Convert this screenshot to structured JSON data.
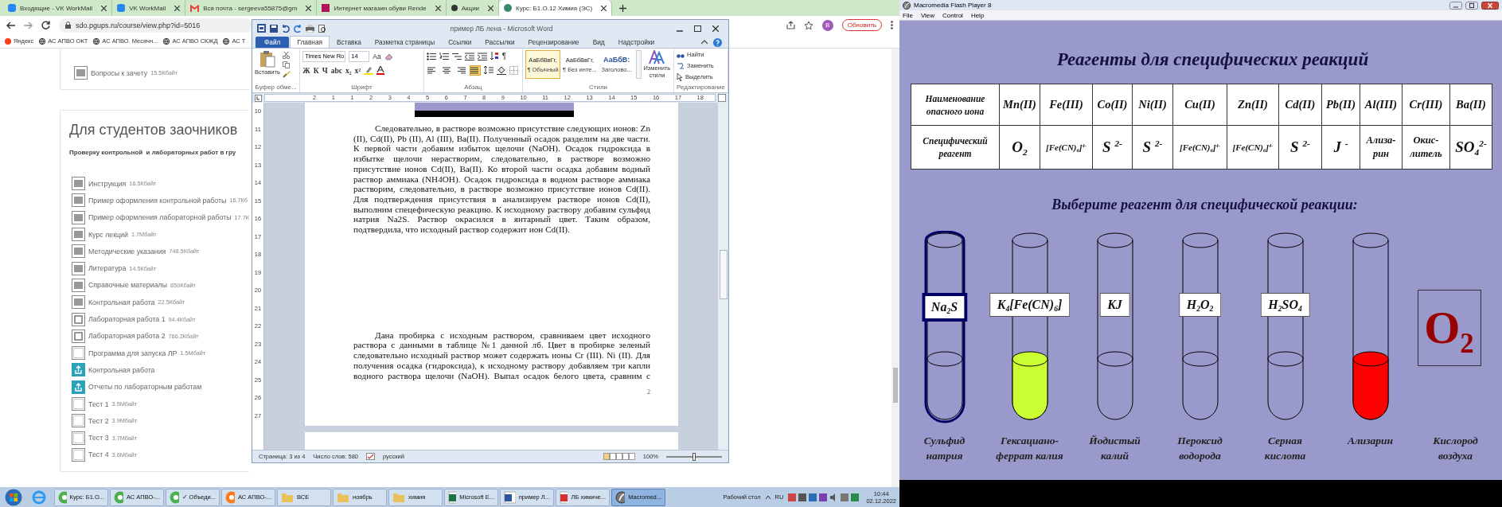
{
  "browser": {
    "tabs": [
      {
        "title": "Входящие - VK WorkMail",
        "selected": false
      },
      {
        "title": "VK WorkMail",
        "selected": false
      },
      {
        "title": "Вся почта - sergeeva55875@gm",
        "selected": false
      },
      {
        "title": "Интернет магазин обуви Rende",
        "selected": false
      },
      {
        "title": "Акции",
        "selected": false
      },
      {
        "title": "Курс: Б1.О.12 Химия (ЭС)",
        "selected": true
      }
    ],
    "address": "sdo.pgups.ru/course/view.php?id=5016",
    "avatar": "В",
    "update_button": "Обновить",
    "bookmarks": [
      "Яндекс",
      "АС АПВО ОКТ",
      "АС АПВО. Месячн...",
      "АС АПВО СКЖД",
      "АС Т"
    ],
    "top_item": {
      "name": "Вопросы к зачету",
      "size": "15.5Кбайт"
    },
    "section": {
      "heading": "Для студентов заочников",
      "subtitle": "Проверку контрольной  и лабораторных работ в гру",
      "files": [
        {
          "name": "Инструкция",
          "size": "16.5Кбайт",
          "kind": "doc"
        },
        {
          "name": "Пример оформления контрольной работы",
          "size": "16.7Кб",
          "kind": "doc"
        },
        {
          "name": "Пример оформления лабораторной работы",
          "size": "17.7К",
          "kind": "doc"
        },
        {
          "name": "Курс лекций",
          "size": "1.7Мбайт",
          "kind": "doc"
        },
        {
          "name": "Методические указания",
          "size": "748.5Кбайт",
          "kind": "doc"
        },
        {
          "name": "Литература",
          "size": "14.5Кбайт",
          "kind": "doc"
        },
        {
          "name": "Справочные материалы",
          "size": "859Кбайт",
          "kind": "doc"
        },
        {
          "name": "Контрольная работа",
          "size": "22.5Кбайт",
          "kind": "doc"
        },
        {
          "name": "Лабораторная работа 1",
          "size": "94.4Кбайт",
          "kind": "archive"
        },
        {
          "name": "Лабораторная работа 2",
          "size": "786.2Кбайт",
          "kind": "archive"
        },
        {
          "name": "Программа для запуска ЛР",
          "size": "1.5Мбайт",
          "kind": "file"
        },
        {
          "name": "Контрольная работа",
          "kind": "assign"
        },
        {
          "name": "Отчеты по лабораторным работам",
          "kind": "assign"
        },
        {
          "name": "Тест 1",
          "size": "3.5Мбайт",
          "kind": "file"
        },
        {
          "name": "Тест 2",
          "size": "3.9Мбайт",
          "kind": "file"
        },
        {
          "name": "Тест 3",
          "size": "3.7Мбайт",
          "kind": "file"
        },
        {
          "name": "Тест 4",
          "size": "3.6Мбайт",
          "kind": "file"
        }
      ]
    }
  },
  "word": {
    "title": "пример ЛБ лена - Microsoft Word",
    "tabs": [
      {
        "label": "Файл",
        "kind": "file",
        "selected": false
      },
      {
        "label": "Главная",
        "kind": "tab",
        "selected": true
      },
      {
        "label": "Вставка",
        "kind": "tab",
        "selected": false
      },
      {
        "label": "Разметка страницы",
        "kind": "tab",
        "selected": false
      },
      {
        "label": "Ссылки",
        "kind": "tab",
        "selected": false
      },
      {
        "label": "Рассылки",
        "kind": "tab",
        "selected": false
      },
      {
        "label": "Рецензирование",
        "kind": "tab",
        "selected": false
      },
      {
        "label": "Вид",
        "kind": "tab",
        "selected": false
      },
      {
        "label": "Надстройки",
        "kind": "tab",
        "selected": false
      }
    ],
    "paste": "Вставить",
    "font_name": "Times New Ro",
    "font_size": "14",
    "case_button": "Aa",
    "font_buttons": [
      "Ж",
      "К",
      "Ч",
      "abc",
      "x₂",
      "x²"
    ],
    "pilcrow": "¶",
    "alignments": [
      {
        "kind": "left",
        "selected": false
      },
      {
        "kind": "center",
        "selected": false
      },
      {
        "kind": "right",
        "selected": false
      },
      {
        "kind": "justify",
        "selected": true
      }
    ],
    "styles": [
      {
        "sample": "АаБбВвГг,",
        "name": "¶ Обычный",
        "kind": "normal",
        "selected": true
      },
      {
        "sample": "АаБбВвГг,",
        "name": "¶ Без инте...",
        "kind": "normal",
        "selected": false
      },
      {
        "sample": "АаБбВ:",
        "name": "Заголово...",
        "kind": "heading",
        "selected": false
      }
    ],
    "change_styles": "Изменить стили",
    "editing": [
      "Найти",
      "Заменить",
      "Выделить"
    ],
    "groups": [
      "Буфер обме...",
      "Шрифт",
      "Абзац",
      "Стили",
      "Редактирование"
    ],
    "ruler": [
      "2",
      "1",
      "1",
      "2",
      "3",
      "4",
      "5",
      "6",
      "7",
      "8",
      "9",
      "10",
      "11",
      "12",
      "13",
      "14",
      "15",
      "16",
      "17",
      "18"
    ],
    "vruler": [
      "10",
      "11",
      "12",
      "13",
      "14",
      "15",
      "16",
      "17",
      "18",
      "19",
      "20",
      "21",
      "22",
      "23",
      "24",
      "25",
      "26",
      "27"
    ],
    "paragraphs": [
      {
        "text": "Следовательно, в растворе возможно присутствие следующих ионов: Zn (II), Cd(II), Pb (II), Al (III), Ba(II). Полученный осадок разделим на две части. К первой части добавим избыток щелочи (NaOH). Осадок гидроксида в избытке щелочи нерастворим, следовательно, в растворе возможно присутствие ионов Cd(II), Ba(II). Ко второй части осадка добавим водный раствор аммиака (NH4OH). Осадок гидроксида в водном растворе аммиака растворим, следовательно, в растворе возможно присутствие ионов Cd(II). Для подтверждения присутствия в анализируем растворе ионов Cd(II), выполним спецефическую реакцию. К исходному раствору добавим сульфид натрия Na2S. Раствор окрасился в янтарный цвет. Таким образом, подтвердила, что исходный раствор содержит ион Cd(II)."
      },
      {
        "text": "Дана пробирка с исходным раствором, сравниваем цвет исходного раствора с данными в таблице №1 данной лб. Цвет в пробирке зеленый следовательно исходный раствор может содержать ионы Cr (III). Ni (II). Для получения осадка (гидроксида), к исходному раствору добавляем три капли водного раствора щелочи (NaOH). Выпал осадок белого цвета, сравним с"
      }
    ],
    "page_number": "2",
    "status": [
      "Страница: 3 из 4",
      "Число слов: 580",
      "русский"
    ],
    "zoom": {
      "label": "100%",
      "level": 0.5
    }
  },
  "flash": {
    "window_title": "Macromedia Flash Player 8",
    "menu": [
      "File",
      "View",
      "Control",
      "Help"
    ],
    "title": "Реагенты для специфических реакций",
    "table": {
      "header_label": "Наименование опасного иона",
      "reagent_label": "Специфический реагент",
      "columns": [
        {
          "ion": "Mn(II)",
          "reagent": "O$_{2}$",
          "kind": "formula"
        },
        {
          "ion": "Fe(III)",
          "reagent": "[Fe(CN)$_{6}$]$^{4-}$",
          "kind": "complex"
        },
        {
          "ion": "Co(II)",
          "reagent": "S $^{2-}$",
          "kind": "formula"
        },
        {
          "ion": "Ni(II)",
          "reagent": "S $^{2-}$",
          "kind": "formula"
        },
        {
          "ion": "Cu(II)",
          "reagent": "[Fe(CN)$_{6}$]$^{4-}$",
          "kind": "complex"
        },
        {
          "ion": "Zn(II)",
          "reagent": "[Fe(CN)$_{6}$]$^{4-}$",
          "kind": "complex"
        },
        {
          "ion": "Cd(II)",
          "reagent": "S $^{2-}$",
          "kind": "formula"
        },
        {
          "ion": "Pb(II)",
          "reagent": "J $^{-}$",
          "kind": "formula"
        },
        {
          "ion": "Al(III)",
          "reagent": "Ализа-\nрин",
          "kind": "word"
        },
        {
          "ion": "Cr(III)",
          "reagent": "Окис-\nлитель",
          "kind": "word"
        },
        {
          "ion": "Ba(II)",
          "reagent": "SO$_{4}$$^{2-}$",
          "kind": "formula"
        }
      ]
    },
    "prompt": "Выберите реагент для специфической реакции:",
    "reagents": [
      {
        "kind": "tube",
        "formula": "Na$_{2}$S",
        "caption": "Сульфид\nнатрия",
        "selected": true
      },
      {
        "kind": "tube",
        "formula": "K$_{4}$[Fe(CN)$_{6}$]",
        "caption": "Гексациано-\nферрат калия",
        "color": "#ccff33",
        "selected": false
      },
      {
        "kind": "tube",
        "formula": "KJ",
        "caption": "Йодистый\nкалий",
        "selected": false
      },
      {
        "kind": "tube",
        "formula": "H$_{2}$O$_{2}$",
        "caption": "Пероксид\nводорода",
        "selected": false
      },
      {
        "kind": "tube",
        "formula": "H$_{2}$SO$_{4}$",
        "caption": "Серная\nкислота",
        "selected": false
      },
      {
        "kind": "tube",
        "caption": "Ализарин",
        "color": "#ff0000",
        "selected": false
      },
      {
        "kind": "box",
        "formula": "O$_{2}$",
        "caption": "Кислород\nвоздуха",
        "selected": false
      }
    ]
  },
  "taskbar": {
    "items": [
      {
        "label": "Курс: Б1.О...",
        "selected": false
      },
      {
        "label": "АС АПВО-...",
        "selected": false
      },
      {
        "label": "✓ Объеди...",
        "selected": false
      },
      {
        "label": "АС АПВО-...",
        "selected": false
      },
      {
        "label": "ВСЕ",
        "selected": false
      },
      {
        "label": "ноябрь",
        "selected": false
      },
      {
        "label": "химия",
        "selected": false
      },
      {
        "label": "Microsoft E...",
        "selected": false
      },
      {
        "label": "пример Л...",
        "selected": false
      },
      {
        "label": "ЛБ химиче...",
        "selected": false
      },
      {
        "label": "Macromed...",
        "selected": true
      }
    ],
    "desktop": "Рабочий стол",
    "lang": "RU",
    "time": "10:44",
    "date": "02.12.2022"
  }
}
